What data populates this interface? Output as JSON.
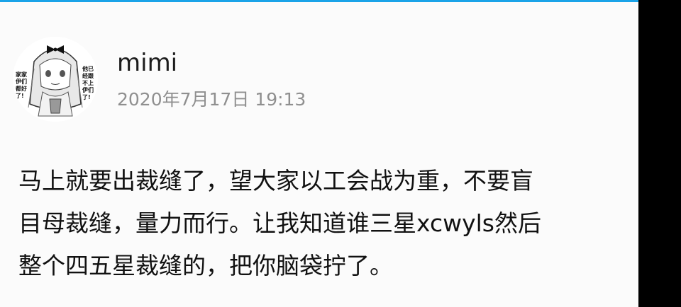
{
  "post": {
    "author": {
      "name": "mimi",
      "avatar_icon": "anime-girl-avatar-icon",
      "avatar_text_left": [
        "家家",
        "伊们",
        "都好",
        "了!"
      ],
      "avatar_text_right": [
        "他已",
        "经跟",
        "不上",
        "伊们",
        "了!"
      ]
    },
    "timestamp": "2020年7月17日 19:13",
    "body_lines": [
      "马上就要出裁缝了，望大家以工会战为重，不要盲",
      "目母裁缝，量力而行。让我知道谁三星xcwyls然后",
      "整个四五星裁缝的，把你脑袋拧了。"
    ]
  },
  "colors": {
    "accent_bar": "#1aa3e8",
    "card_background": "#fbfbfb",
    "side_bar": "#000000",
    "author_text": "#1c1c1c",
    "timestamp_text": "#8f8f8f",
    "body_text": "#111111"
  }
}
